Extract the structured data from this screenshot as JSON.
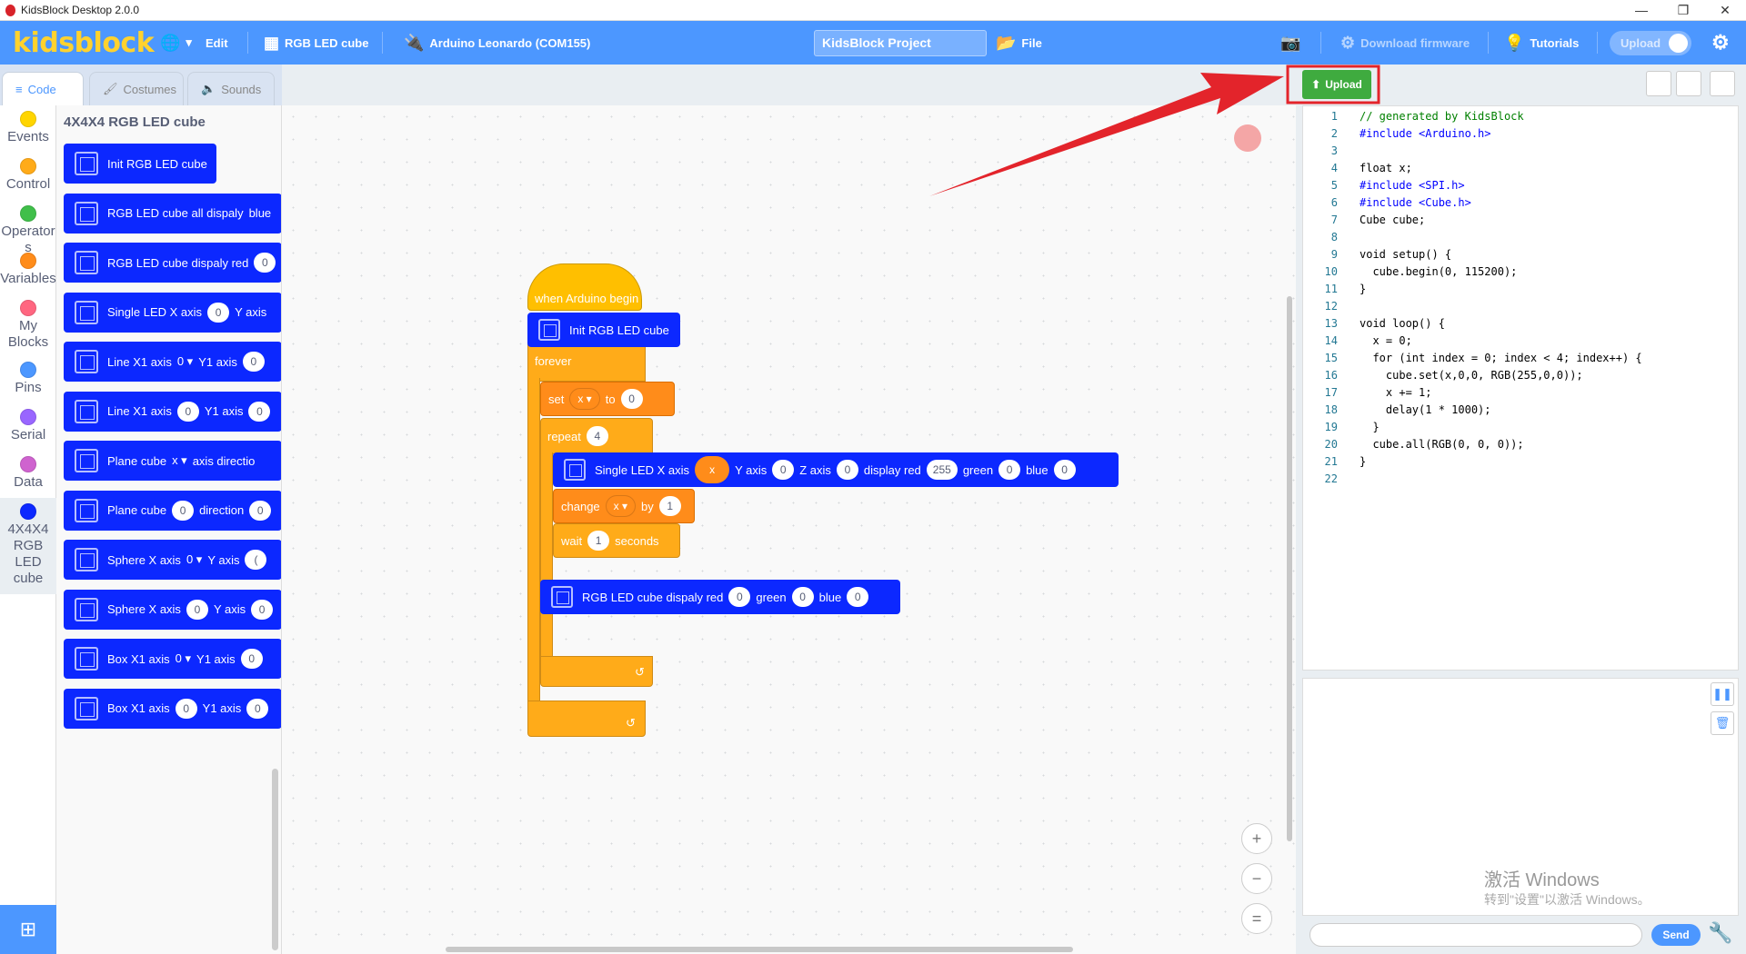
{
  "window": {
    "title": "KidsBlock Desktop 2.0.0",
    "minimize": "—",
    "restore": "❐",
    "close": "✕"
  },
  "menubar": {
    "logo": "kidsblock",
    "edit": "Edit",
    "extension": "RGB LED cube",
    "device": "Arduino Leonardo (COM155)",
    "project_name": "KidsBlock Project",
    "file": "File",
    "download_firmware": "Download firmware",
    "tutorials": "Tutorials",
    "upload_toggle": "Upload"
  },
  "tabs": {
    "code": "Code",
    "costumes": "Costumes",
    "sounds": "Sounds"
  },
  "categories": [
    {
      "label": "Events",
      "color": "#ffd500"
    },
    {
      "label": "Control",
      "color": "#ffab19"
    },
    {
      "label": "Operators",
      "color": "#40bf4a"
    },
    {
      "label": "Variables",
      "color": "#ff8c1a"
    },
    {
      "label": "My Blocks",
      "color": "#ff6680"
    },
    {
      "label": "Pins",
      "color": "#4c97ff"
    },
    {
      "label": "Serial",
      "color": "#9966ff"
    },
    {
      "label": "Data",
      "color": "#cf63cf"
    },
    {
      "label": "4X4X4 RGB LED cube",
      "color": "#0c28ff"
    }
  ],
  "flyout": {
    "header": "4X4X4 RGB LED cube",
    "blocks": [
      {
        "text": "Init RGB LED cube"
      },
      {
        "text": "RGB LED cube all dispaly",
        "extra": "blue"
      },
      {
        "text": "RGB LED cube dispaly red",
        "value": "0"
      },
      {
        "text": "Single LED X axis",
        "value": "0",
        "after": "Y axis"
      },
      {
        "text": "Line X1 axis",
        "dropdown": "0 ▾",
        "after": "Y1 axis",
        "tail": "0"
      },
      {
        "text": "Line X1 axis",
        "value": "0",
        "after": "Y1 axis",
        "tail": "0"
      },
      {
        "text": "Plane cube",
        "dropdown": "x ▾",
        "after": "axis directio"
      },
      {
        "text": "Plane cube",
        "value": "0",
        "after": "direction",
        "tail": "0"
      },
      {
        "text": "Sphere X axis",
        "dropdown": "0 ▾",
        "after": "Y axis",
        "tail": "("
      },
      {
        "text": "Sphere X axis",
        "value": "0",
        "after": "Y axis",
        "tail": "0"
      },
      {
        "text": "Box X1 axis",
        "dropdown": "0 ▾",
        "after": "Y1 axis",
        "tail": "0"
      },
      {
        "text": "Box X1 axis",
        "value": "0",
        "after": "Y1 axis",
        "tail": "0"
      }
    ]
  },
  "script": {
    "hat": "when Arduino begin",
    "init": "Init RGB LED cube",
    "forever": "forever",
    "set": {
      "label": "set",
      "var": "x",
      "to": "to",
      "value": "0"
    },
    "repeat": {
      "label": "repeat",
      "value": "4"
    },
    "single": {
      "label": "Single LED X axis",
      "x": "x",
      "y_label": "Y axis",
      "y": "0",
      "z_label": "Z axis",
      "z": "0",
      "red_label": "display red",
      "red": "255",
      "green_label": "green",
      "green": "0",
      "blue_label": "blue",
      "blue": "0"
    },
    "change": {
      "label": "change",
      "var": "x",
      "by": "by",
      "value": "1"
    },
    "wait": {
      "label": "wait",
      "value": "1",
      "unit": "seconds"
    },
    "display": {
      "label": "RGB LED cube dispaly red",
      "red": "0",
      "green_label": "green",
      "green": "0",
      "blue_label": "blue",
      "blue": "0"
    }
  },
  "right": {
    "upload": "Upload"
  },
  "code_lines": [
    "// generated by KidsBlock",
    "#include <Arduino.h>",
    "",
    "float x;",
    "#include <SPI.h>",
    "#include <Cube.h>",
    "Cube cube;",
    "",
    "void setup() {",
    "  cube.begin(0, 115200);",
    "}",
    "",
    "void loop() {",
    "  x = 0;",
    "  for (int index = 0; index < 4; index++) {",
    "    cube.set(x,0,0, RGB(255,0,0));",
    "    x += 1;",
    "    delay(1 * 1000);",
    "  }",
    "  cube.all(RGB(0, 0, 0));",
    "}",
    ""
  ],
  "serial": {
    "send": "Send",
    "watermark": "激活 Windows",
    "watermark_sub": "转到\"设置\"以激活 Windows。"
  },
  "zoom": {
    "in": "+",
    "out": "−",
    "reset": "="
  },
  "colors": {
    "accent": "#4c97ff",
    "cube_block": "#0c28ff",
    "control": "#ffab19",
    "event": "#ffbf00",
    "annotation": "#e3242b",
    "upload_green": "#3fab3f"
  }
}
